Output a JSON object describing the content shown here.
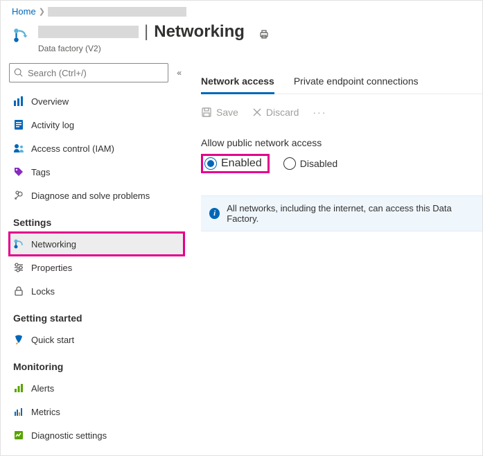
{
  "breadcrumb": {
    "home_label": "Home"
  },
  "header": {
    "page_title": "Networking",
    "resource_type": "Data factory (V2)"
  },
  "sidebar": {
    "search_placeholder": "Search (Ctrl+/)",
    "items": [
      {
        "label": "Overview"
      },
      {
        "label": "Activity log"
      },
      {
        "label": "Access control (IAM)"
      },
      {
        "label": "Tags"
      },
      {
        "label": "Diagnose and solve problems"
      }
    ],
    "sections": {
      "settings": {
        "title": "Settings",
        "items": [
          {
            "label": "Networking"
          },
          {
            "label": "Properties"
          },
          {
            "label": "Locks"
          }
        ]
      },
      "getting_started": {
        "title": "Getting started",
        "items": [
          {
            "label": "Quick start"
          }
        ]
      },
      "monitoring": {
        "title": "Monitoring",
        "items": [
          {
            "label": "Alerts"
          },
          {
            "label": "Metrics"
          },
          {
            "label": "Diagnostic settings"
          }
        ]
      }
    }
  },
  "main": {
    "tabs": [
      {
        "label": "Network access"
      },
      {
        "label": "Private endpoint connections"
      }
    ],
    "toolbar": {
      "save": "Save",
      "discard": "Discard"
    },
    "network_access": {
      "label": "Allow public network access",
      "enabled": "Enabled",
      "disabled": "Disabled"
    },
    "info_text": "All networks, including the internet, can access this Data Factory."
  }
}
